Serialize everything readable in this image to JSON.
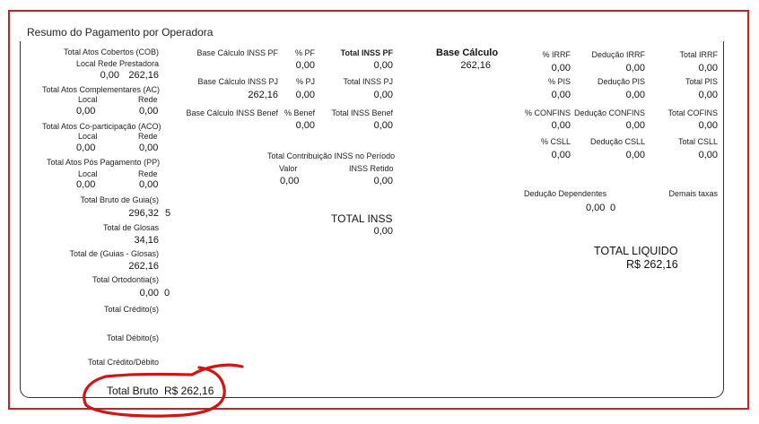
{
  "title": "Resumo do Pagamento por Operadora",
  "left": {
    "cob_label": "Total Atos Cobertos (COB)",
    "cob_sub_label": "Local Rede Prestadora",
    "cob_local": "0,00",
    "cob_rede": "262,16",
    "ac_label": "Total Atos Complementares (AC)",
    "ac_local_label": "Local",
    "ac_rede_label": "Rede",
    "ac_local": "0,00",
    "ac_rede": "0,00",
    "aco_label": "Total Atos Co-participação (ACO)",
    "aco_local_label": "Local",
    "aco_rede_label": "Rede",
    "aco_local": "0,00",
    "aco_rede": "0,00",
    "pp_label": "Total Atos Pós Pagamento (PP)",
    "pp_local_label": "Local",
    "pp_rede_label": "Rede",
    "pp_local": "0,00",
    "pp_rede": "0,00",
    "bruto_guia_label": "Total Bruto de Guia(s)",
    "bruto_guia_value": "296,32",
    "bruto_guia_count": "5",
    "glosas_label": "Total de Glosas",
    "glosas_value": "34,16",
    "guias_glosas_label": "Total de (Guias - Glosas)",
    "guias_glosas_value": "262,16",
    "ortodontia_label": "Total Ortodontia(s)",
    "ortodontia_value": "0,00",
    "ortodontia_count": "0",
    "credito_label": "Total Crédito(s)",
    "debito_label": "Total Débito(s)",
    "credito_debito_label": "Total Crédito/Débito",
    "total_bruto_label": "Total Bruto",
    "total_bruto_value": "R$ 262,16"
  },
  "inss": {
    "base_pf_label": "Base Cálculo INSS PF",
    "pct_pf_label": "% PF",
    "total_pf_label": "Total INSS PF",
    "pct_pf_value": "0,00",
    "total_pf_value": "0,00",
    "base_pj_label": "Base Cálculo INSS PJ",
    "pct_pj_label": "% PJ",
    "total_pj_label": "Total INSS PJ",
    "base_pj_value": "262,16",
    "pct_pj_value": "0,00",
    "total_pj_value": "0,00",
    "base_benef_label": "Base Cálculo INSS Benef",
    "pct_benef_label": "% Benef",
    "total_benef_label": "Total INSS Benef",
    "pct_benef_value": "0,00",
    "total_benef_value": "0,00",
    "contrib_label": "Total Contribuição INSS no Período",
    "valor_label": "Valor",
    "retido_label": "INSS Retido",
    "valor_value": "0,00",
    "retido_value": "0,00",
    "total_inss_label": "TOTAL INSS",
    "total_inss_value": "0,00"
  },
  "base": {
    "label": "Base Cálculo",
    "value": "262,16"
  },
  "taxes": {
    "irrf_pct_label": "% IRRF",
    "irrf_ded_label": "Dedução IRRF",
    "irrf_total_label": "Total IRRF",
    "irrf_pct": "0,00",
    "irrf_ded": "0,00",
    "irrf_total": "0,00",
    "pis_pct_label": "% PIS",
    "pis_ded_label": "Dedução PIS",
    "pis_total_label": "Total PIS",
    "pis_pct": "0,00",
    "pis_ded": "0,00",
    "pis_total": "0,00",
    "cofins_pct_label": "% CONFINS",
    "cofins_ded_label": "Dedução CONFINS",
    "cofins_total_label": "Total COFINS",
    "cofins_pct": "0,00",
    "cofins_ded": "0,00",
    "cofins_total": "0,00",
    "csll_pct_label": "% CSLL",
    "csll_ded_label": "Dedução CSLL",
    "csll_total_label": "Total CSLL",
    "csll_pct": "0,00",
    "csll_ded": "0,00",
    "csll_total": "0,00",
    "dependentes_label": "Dedução Dependentes",
    "dependentes_value": "0,00",
    "dependentes_count": "0",
    "demais_label": "Demais taxas"
  },
  "liquido": {
    "label": "TOTAL LIQUIDO",
    "value": "R$ 262,16"
  },
  "colors": {
    "frame": "#cc2020",
    "annotation": "#d11414"
  }
}
